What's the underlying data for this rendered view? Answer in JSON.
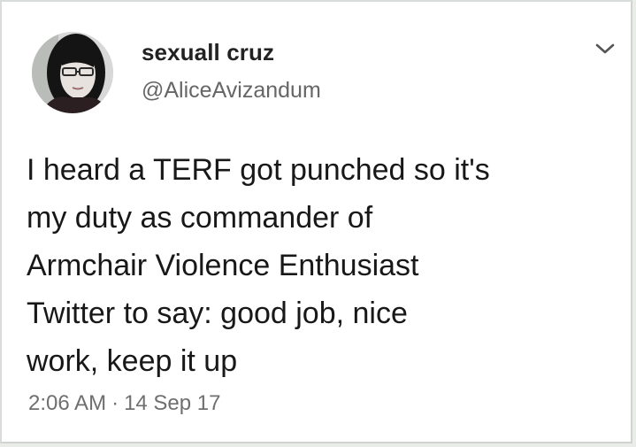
{
  "tweet": {
    "author": {
      "display_name": "sexuall cruz",
      "handle": "@AliceAvizandum"
    },
    "text_lines": [
      "I heard a TERF got punched so it's",
      "my duty as commander of",
      "Armchair Violence Enthusiast",
      "Twitter to say: good job, nice",
      "work, keep it up"
    ],
    "time": "2:06 AM",
    "separator": "·",
    "date": "14 Sep 17"
  },
  "icons": {
    "menu": "chevron-down-icon",
    "avatar": "avatar"
  }
}
